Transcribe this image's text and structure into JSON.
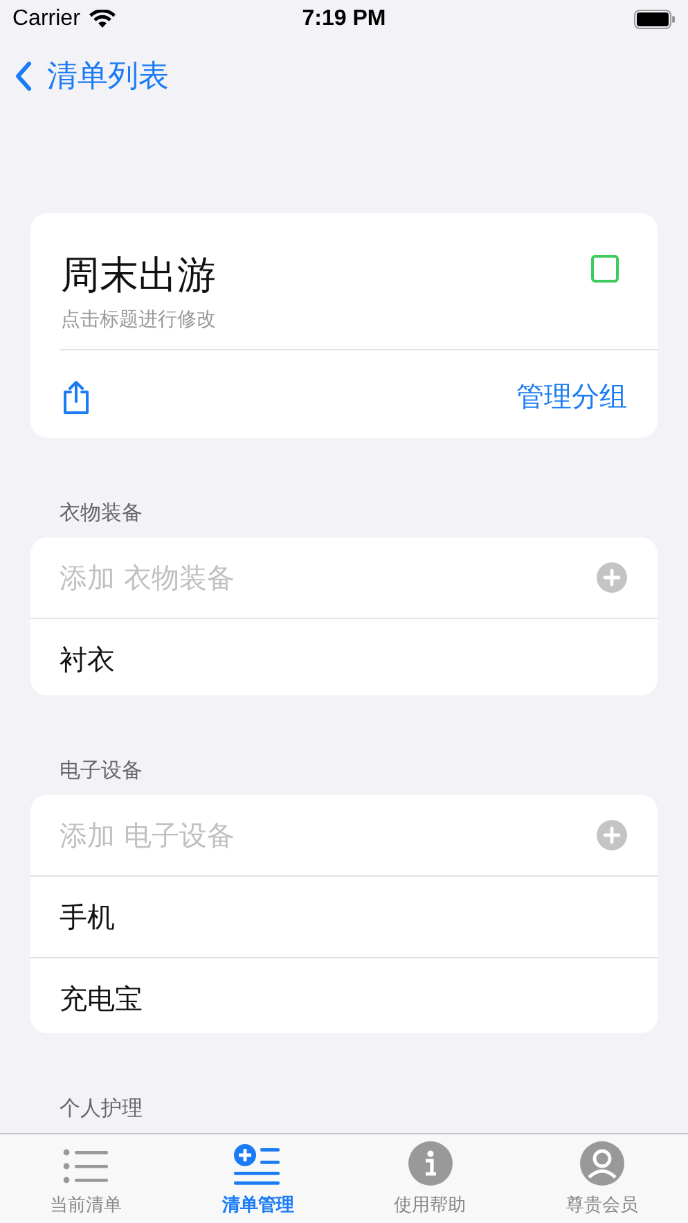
{
  "status_bar": {
    "carrier": "Carrier",
    "time": "7:19 PM"
  },
  "nav": {
    "back_label": "清单列表"
  },
  "list_card": {
    "title": "周末出游",
    "hint": "点击标题进行修改",
    "checked": false,
    "manage_label": "管理分组"
  },
  "groups": [
    {
      "header": "衣物装备",
      "add_placeholder": "添加 衣物装备",
      "items": [
        "衬衣"
      ]
    },
    {
      "header": "电子设备",
      "add_placeholder": "添加 电子设备",
      "items": [
        "手机",
        "充电宝"
      ]
    },
    {
      "header": "个人护理"
    }
  ],
  "tabs": [
    {
      "label": "当前清单",
      "kind": "list",
      "selected": false
    },
    {
      "label": "清单管理",
      "kind": "manage",
      "selected": true
    },
    {
      "label": "使用帮助",
      "kind": "info",
      "selected": false
    },
    {
      "label": "尊贵会员",
      "kind": "person",
      "selected": false
    }
  ]
}
